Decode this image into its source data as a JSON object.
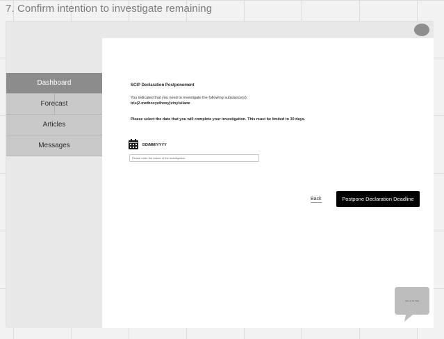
{
  "page": {
    "heading": "7. Confirm intention to investigate remaining"
  },
  "sidebar": {
    "items": [
      {
        "label": "Dashboard",
        "active": true
      },
      {
        "label": "Forecast",
        "active": false
      },
      {
        "label": "Articles",
        "active": false
      },
      {
        "label": "Messages",
        "active": false
      }
    ]
  },
  "header": {
    "avatar_icon": "user-avatar-circle"
  },
  "form": {
    "title": "SCIP Declaration Postponement",
    "intro": "You indicated that you need to investigate the following substance(s):",
    "substance": "tris(2-methoxyethoxy)vinylsilane",
    "instruction": "Please select the date that you will complete your investigation. This must be limited to 30 days.",
    "date_icon": "calendar-icon",
    "date_value": "DD/MM/YYYY",
    "reason_placeholder": "Please enter the nature of the investigation",
    "reason_value": ""
  },
  "actions": {
    "back_label": "Back",
    "submit_label": "Postpone Declaration Deadline"
  },
  "chat": {
    "icon": "chat-bubble-icon",
    "label": "Ask us for help"
  },
  "colors": {
    "active_nav": "#8c8c8c",
    "nav": "#c9c9c9",
    "primary": "#000000",
    "content_bg": "#ffffff"
  }
}
